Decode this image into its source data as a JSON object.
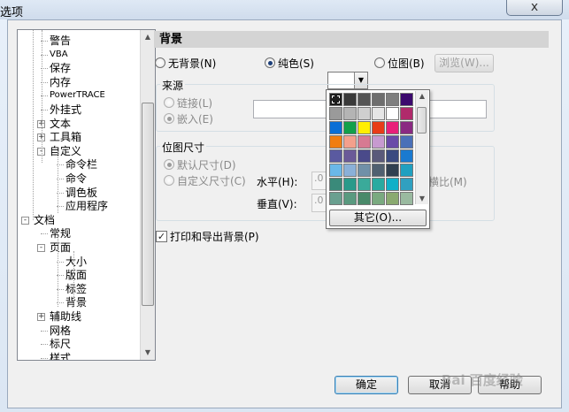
{
  "window": {
    "title": "选项",
    "close": "x"
  },
  "tree": {
    "items": [
      {
        "label": "警告",
        "indent": 2
      },
      {
        "label": "VBA",
        "indent": 2,
        "small": true
      },
      {
        "label": "保存",
        "indent": 2
      },
      {
        "label": "内存",
        "indent": 2
      },
      {
        "label": "PowerTRACE",
        "indent": 2,
        "small": true
      },
      {
        "label": "外挂式",
        "indent": 2
      },
      {
        "label": "文本",
        "indent": 2,
        "expander": "+"
      },
      {
        "label": "工具箱",
        "indent": 2,
        "expander": "+"
      },
      {
        "label": "自定义",
        "indent": 2,
        "expander": "-"
      },
      {
        "label": "命令栏",
        "indent": 3
      },
      {
        "label": "命令",
        "indent": 3
      },
      {
        "label": "调色板",
        "indent": 3
      },
      {
        "label": "应用程序",
        "indent": 3
      },
      {
        "label": "文档",
        "indent": 1,
        "expander": "-"
      },
      {
        "label": "常规",
        "indent": 2
      },
      {
        "label": "页面",
        "indent": 2,
        "expander": "-"
      },
      {
        "label": "大小",
        "indent": 3
      },
      {
        "label": "版面",
        "indent": 3
      },
      {
        "label": "标签",
        "indent": 3
      },
      {
        "label": "背景",
        "indent": 3
      },
      {
        "label": "辅助线",
        "indent": 2,
        "expander": "+"
      },
      {
        "label": "网格",
        "indent": 2
      },
      {
        "label": "标尺",
        "indent": 2
      },
      {
        "label": "样式",
        "indent": 2
      }
    ]
  },
  "panel": {
    "header": "背景",
    "bg_options": {
      "none": "无背景(N)",
      "solid": "纯色(S)",
      "bitmap": "位图(B)",
      "browse": "浏览(W)..."
    },
    "source": {
      "legend": "来源",
      "link": "链接(L)",
      "embed": "嵌入(E)"
    },
    "size": {
      "legend": "位图尺寸",
      "default": "默认尺寸(D)",
      "custom": "自定义尺寸(C)",
      "horizontal": "水平(H):",
      "vertical": "垂直(V):",
      "h_value": ".0",
      "v_value": ".0",
      "keep_ratio": "纵横比(M)"
    },
    "print_export": "打印和导出背景(P)"
  },
  "palette": {
    "other": "其它(O)...",
    "colors": [
      "#1e1e1e",
      "#3a3a3a",
      "#555555",
      "#6e6e6e",
      "#7f7f7f",
      "#3c0a6e",
      "#9a9a9a",
      "#b4b4b4",
      "#cfcfcf",
      "#e6e6e6",
      "#ffffff",
      "#b02a6b",
      "#0a6fd6",
      "#13a04a",
      "#ffee00",
      "#e83c18",
      "#e8207a",
      "#8a2a82",
      "#f07d10",
      "#f4a08c",
      "#d77a92",
      "#c79ad0",
      "#6a4aa8",
      "#4a70b8",
      "#5a5aa0",
      "#6a5a98",
      "#4a4a8a",
      "#5a5a7a",
      "#3a4a80",
      "#1a7ad0",
      "#6ab8e8",
      "#8ab0d8",
      "#7090a8",
      "#506070",
      "#304050",
      "#20a0c0",
      "#3a8a7a",
      "#2a9a8a",
      "#3aaa9a",
      "#2aaaa0",
      "#10b0c8",
      "#30a0c0",
      "#6aa090",
      "#5a9a80",
      "#4a8a6a",
      "#7aaa80",
      "#8aaa70",
      "#9abaa0"
    ]
  },
  "buttons": {
    "ok": "确定",
    "cancel": "取消",
    "help": "帮助"
  },
  "watermark": "Bai 百度经验"
}
